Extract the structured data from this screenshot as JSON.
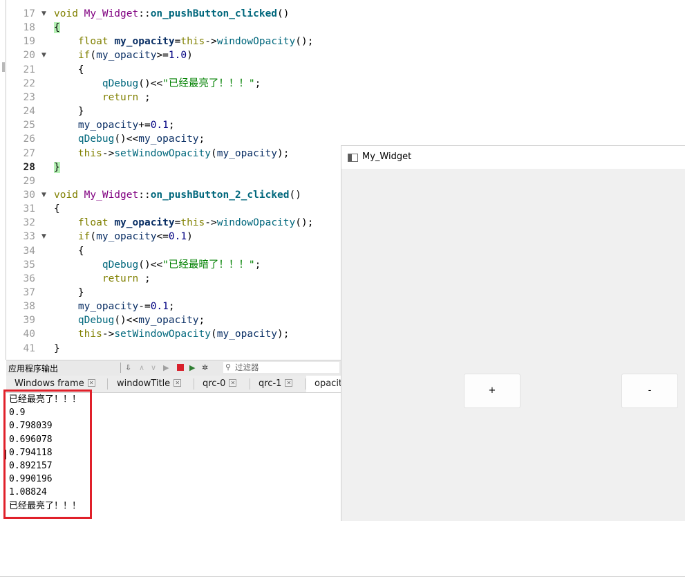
{
  "editor": {
    "lines": [
      {
        "num": "17",
        "fold": "▼",
        "tokens": [
          [
            "void ",
            "kw"
          ],
          [
            "My_Widget",
            "cls"
          ],
          [
            "::",
            "op"
          ],
          [
            "on_pushButton_clicked",
            "fn"
          ],
          [
            "()",
            "op"
          ]
        ]
      },
      {
        "num": "18",
        "fold": "",
        "tokens": [
          [
            "{",
            "brace"
          ]
        ]
      },
      {
        "num": "19",
        "fold": "",
        "tokens": [
          [
            "    ",
            "op"
          ],
          [
            "float ",
            "kw"
          ],
          [
            "my_opacity",
            "var"
          ],
          [
            "=",
            "op"
          ],
          [
            "this",
            "kw"
          ],
          [
            "->",
            "op"
          ],
          [
            "windowOpacity",
            "mem"
          ],
          [
            "();",
            "op"
          ]
        ]
      },
      {
        "num": "20",
        "fold": "▼",
        "tokens": [
          [
            "    ",
            "op"
          ],
          [
            "if",
            "kw"
          ],
          [
            "(",
            "op"
          ],
          [
            "my_opacity",
            "id"
          ],
          [
            ">=",
            "op"
          ],
          [
            "1.0",
            "num"
          ],
          [
            ")",
            "op"
          ]
        ]
      },
      {
        "num": "21",
        "fold": "",
        "tokens": [
          [
            "    {",
            "op"
          ]
        ]
      },
      {
        "num": "22",
        "fold": "",
        "tokens": [
          [
            "        ",
            "op"
          ],
          [
            "qDebug",
            "mem"
          ],
          [
            "()<<",
            "op"
          ],
          [
            "\"已经最亮了！！！\"",
            "str"
          ],
          [
            ";",
            "op"
          ]
        ]
      },
      {
        "num": "23",
        "fold": "",
        "tokens": [
          [
            "        ",
            "op"
          ],
          [
            "return",
            "kw"
          ],
          [
            " ;",
            "op"
          ]
        ]
      },
      {
        "num": "24",
        "fold": "",
        "tokens": [
          [
            "    }",
            "op"
          ]
        ]
      },
      {
        "num": "25",
        "fold": "",
        "tokens": [
          [
            "    ",
            "op"
          ],
          [
            "my_opacity",
            "id"
          ],
          [
            "+=",
            "op"
          ],
          [
            "0.1",
            "num"
          ],
          [
            ";",
            "op"
          ]
        ]
      },
      {
        "num": "26",
        "fold": "",
        "tokens": [
          [
            "    ",
            "op"
          ],
          [
            "qDebug",
            "mem"
          ],
          [
            "()<<",
            "op"
          ],
          [
            "my_opacity",
            "id"
          ],
          [
            ";",
            "op"
          ]
        ]
      },
      {
        "num": "27",
        "fold": "",
        "tokens": [
          [
            "    ",
            "op"
          ],
          [
            "this",
            "kw"
          ],
          [
            "->",
            "op"
          ],
          [
            "setWindowOpacity",
            "mem"
          ],
          [
            "(",
            "op"
          ],
          [
            "my_opacity",
            "id"
          ],
          [
            ");",
            "op"
          ]
        ]
      },
      {
        "num": "28",
        "fold": "",
        "current": true,
        "tokens": [
          [
            "}",
            "brace"
          ]
        ]
      },
      {
        "num": "29",
        "fold": "",
        "tokens": []
      },
      {
        "num": "30",
        "fold": "▼",
        "tokens": [
          [
            "void ",
            "kw"
          ],
          [
            "My_Widget",
            "cls"
          ],
          [
            "::",
            "op"
          ],
          [
            "on_pushButton_2_clicked",
            "fn"
          ],
          [
            "()",
            "op"
          ]
        ]
      },
      {
        "num": "31",
        "fold": "",
        "tokens": [
          [
            "{",
            "op"
          ]
        ]
      },
      {
        "num": "32",
        "fold": "",
        "tokens": [
          [
            "    ",
            "op"
          ],
          [
            "float ",
            "kw"
          ],
          [
            "my_opacity",
            "var"
          ],
          [
            "=",
            "op"
          ],
          [
            "this",
            "kw"
          ],
          [
            "->",
            "op"
          ],
          [
            "windowOpacity",
            "mem"
          ],
          [
            "();",
            "op"
          ]
        ]
      },
      {
        "num": "33",
        "fold": "▼",
        "tokens": [
          [
            "    ",
            "op"
          ],
          [
            "if",
            "kw"
          ],
          [
            "(",
            "op"
          ],
          [
            "my_opacity",
            "id"
          ],
          [
            "<=",
            "op"
          ],
          [
            "0.1",
            "num"
          ],
          [
            ")",
            "op"
          ]
        ]
      },
      {
        "num": "34",
        "fold": "",
        "tokens": [
          [
            "    {",
            "op"
          ]
        ]
      },
      {
        "num": "35",
        "fold": "",
        "tokens": [
          [
            "        ",
            "op"
          ],
          [
            "qDebug",
            "mem"
          ],
          [
            "()<<",
            "op"
          ],
          [
            "\"已经最暗了！！！\"",
            "str"
          ],
          [
            ";",
            "op"
          ]
        ]
      },
      {
        "num": "36",
        "fold": "",
        "tokens": [
          [
            "        ",
            "op"
          ],
          [
            "return",
            "kw"
          ],
          [
            " ;",
            "op"
          ]
        ]
      },
      {
        "num": "37",
        "fold": "",
        "tokens": [
          [
            "    }",
            "op"
          ]
        ]
      },
      {
        "num": "38",
        "fold": "",
        "tokens": [
          [
            "    ",
            "op"
          ],
          [
            "my_opacity",
            "id"
          ],
          [
            "-=",
            "op"
          ],
          [
            "0.1",
            "num"
          ],
          [
            ";",
            "op"
          ]
        ]
      },
      {
        "num": "39",
        "fold": "",
        "tokens": [
          [
            "    ",
            "op"
          ],
          [
            "qDebug",
            "mem"
          ],
          [
            "()<<",
            "op"
          ],
          [
            "my_opacity",
            "id"
          ],
          [
            ";",
            "op"
          ]
        ]
      },
      {
        "num": "40",
        "fold": "",
        "tokens": [
          [
            "    ",
            "op"
          ],
          [
            "this",
            "kw"
          ],
          [
            "->",
            "op"
          ],
          [
            "setWindowOpacity",
            "mem"
          ],
          [
            "(",
            "op"
          ],
          [
            "my_opacity",
            "id"
          ],
          [
            ");",
            "op"
          ]
        ]
      },
      {
        "num": "41",
        "fold": "",
        "tokens": [
          [
            "}",
            "op"
          ]
        ]
      }
    ]
  },
  "output_pane": {
    "title": "应用程序输出",
    "filter_placeholder": "过滤器",
    "tabs": [
      {
        "label": "Windows frame",
        "closable": true
      },
      {
        "label": "windowTitle",
        "closable": true
      },
      {
        "label": "qrc-0",
        "closable": true
      },
      {
        "label": "qrc-1",
        "closable": true
      },
      {
        "label": "opacity",
        "closable": false,
        "active": true
      }
    ],
    "lines": [
      "已经最亮了！！！",
      "0.9",
      "0.798039",
      "0.696078",
      "0.794118",
      "0.892157",
      "0.990196",
      "1.08824",
      "已经最亮了！！！"
    ]
  },
  "window": {
    "title": "My_Widget",
    "plus_label": "+",
    "minus_label": "-"
  },
  "colors": {
    "highlight_border": "#e0202a",
    "brace_match": "#b4f0b4"
  }
}
